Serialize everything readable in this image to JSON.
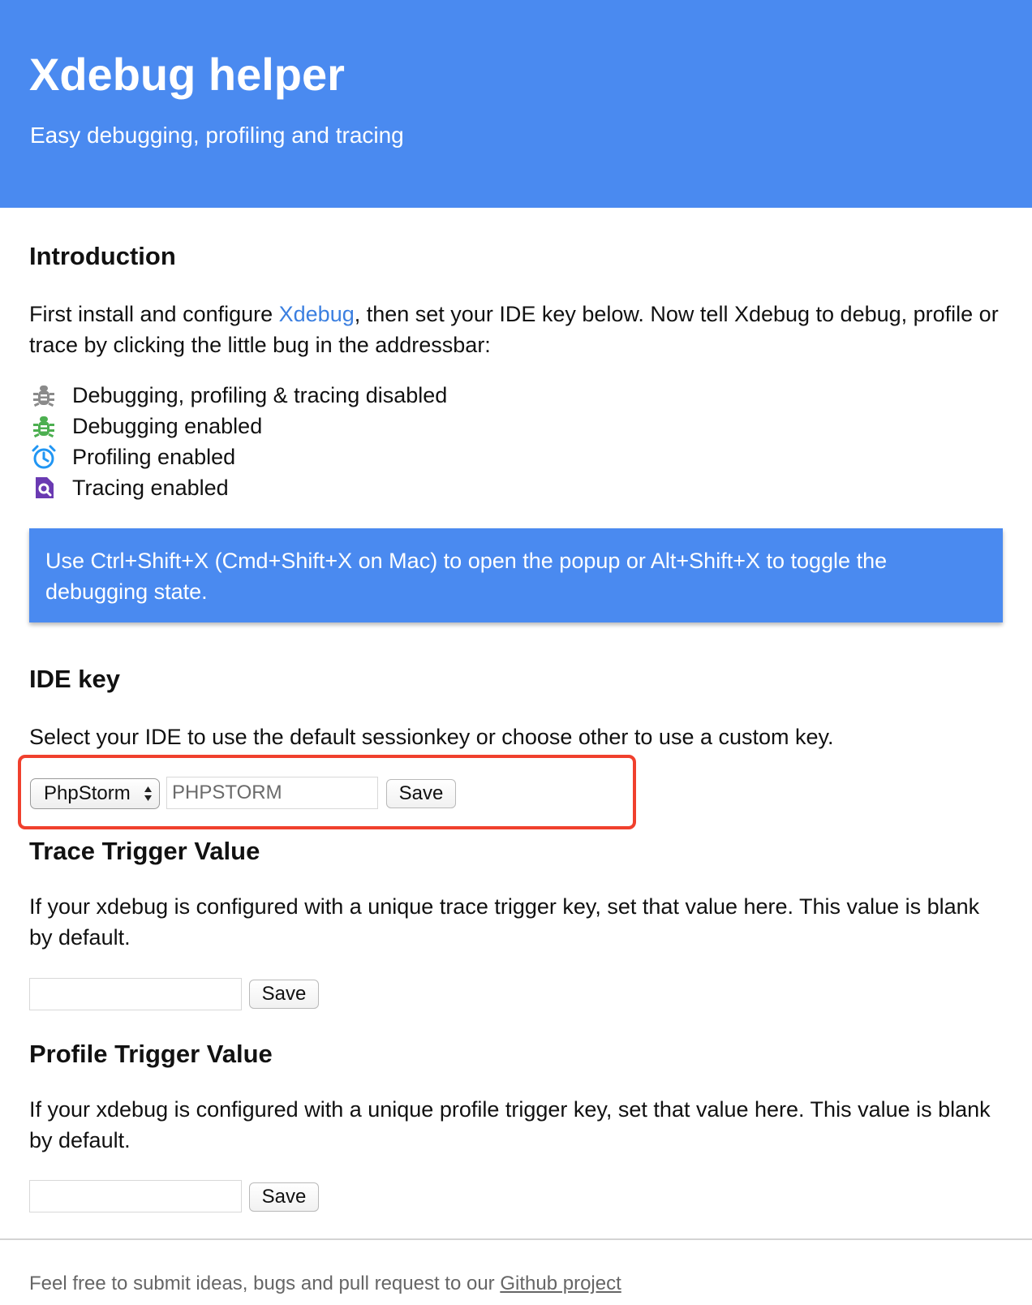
{
  "header": {
    "title": "Xdebug helper",
    "subtitle": "Easy debugging, profiling and tracing"
  },
  "colors": {
    "header_bg": "#4a8af0",
    "link": "#3b7fe0",
    "highlight_border": "#f0402d",
    "bug_disabled": "#8a8a8a",
    "bug_enabled": "#4caf50",
    "profile_icon": "#2196f3",
    "trace_icon": "#6a3ab2"
  },
  "introduction": {
    "heading": "Introduction",
    "text_before_link": "First install and configure ",
    "link_text": "Xdebug",
    "text_after_link": ", then set your IDE key below. Now tell Xdebug to debug, profile or trace by clicking the little bug in the addressbar:",
    "legend": [
      {
        "icon": "bug-disabled-icon",
        "label": "Debugging, profiling & tracing disabled"
      },
      {
        "icon": "bug-enabled-icon",
        "label": "Debugging enabled"
      },
      {
        "icon": "alarm-clock-icon",
        "label": "Profiling enabled"
      },
      {
        "icon": "trace-search-icon",
        "label": "Tracing enabled"
      }
    ],
    "notice": "Use Ctrl+Shift+X (Cmd+Shift+X on Mac) to open the popup or Alt+Shift+X to toggle the debugging state."
  },
  "ide_key": {
    "heading": "IDE key",
    "description": "Select your IDE to use the default sessionkey or choose other to use a custom key.",
    "selected_ide": "PhpStorm",
    "key_value": "PHPSTORM",
    "save_label": "Save"
  },
  "trace_trigger": {
    "heading": "Trace Trigger Value",
    "description": "If your xdebug is configured with a unique trace trigger key, set that value here. This value is blank by default.",
    "value": "",
    "save_label": "Save"
  },
  "profile_trigger": {
    "heading": "Profile Trigger Value",
    "description": "If your xdebug is configured with a unique profile trigger key, set that value here. This value is blank by default.",
    "value": "",
    "save_label": "Save"
  },
  "footer": {
    "text": "Feel free to submit ideas, bugs and pull request to our ",
    "link_text": "Github project"
  }
}
